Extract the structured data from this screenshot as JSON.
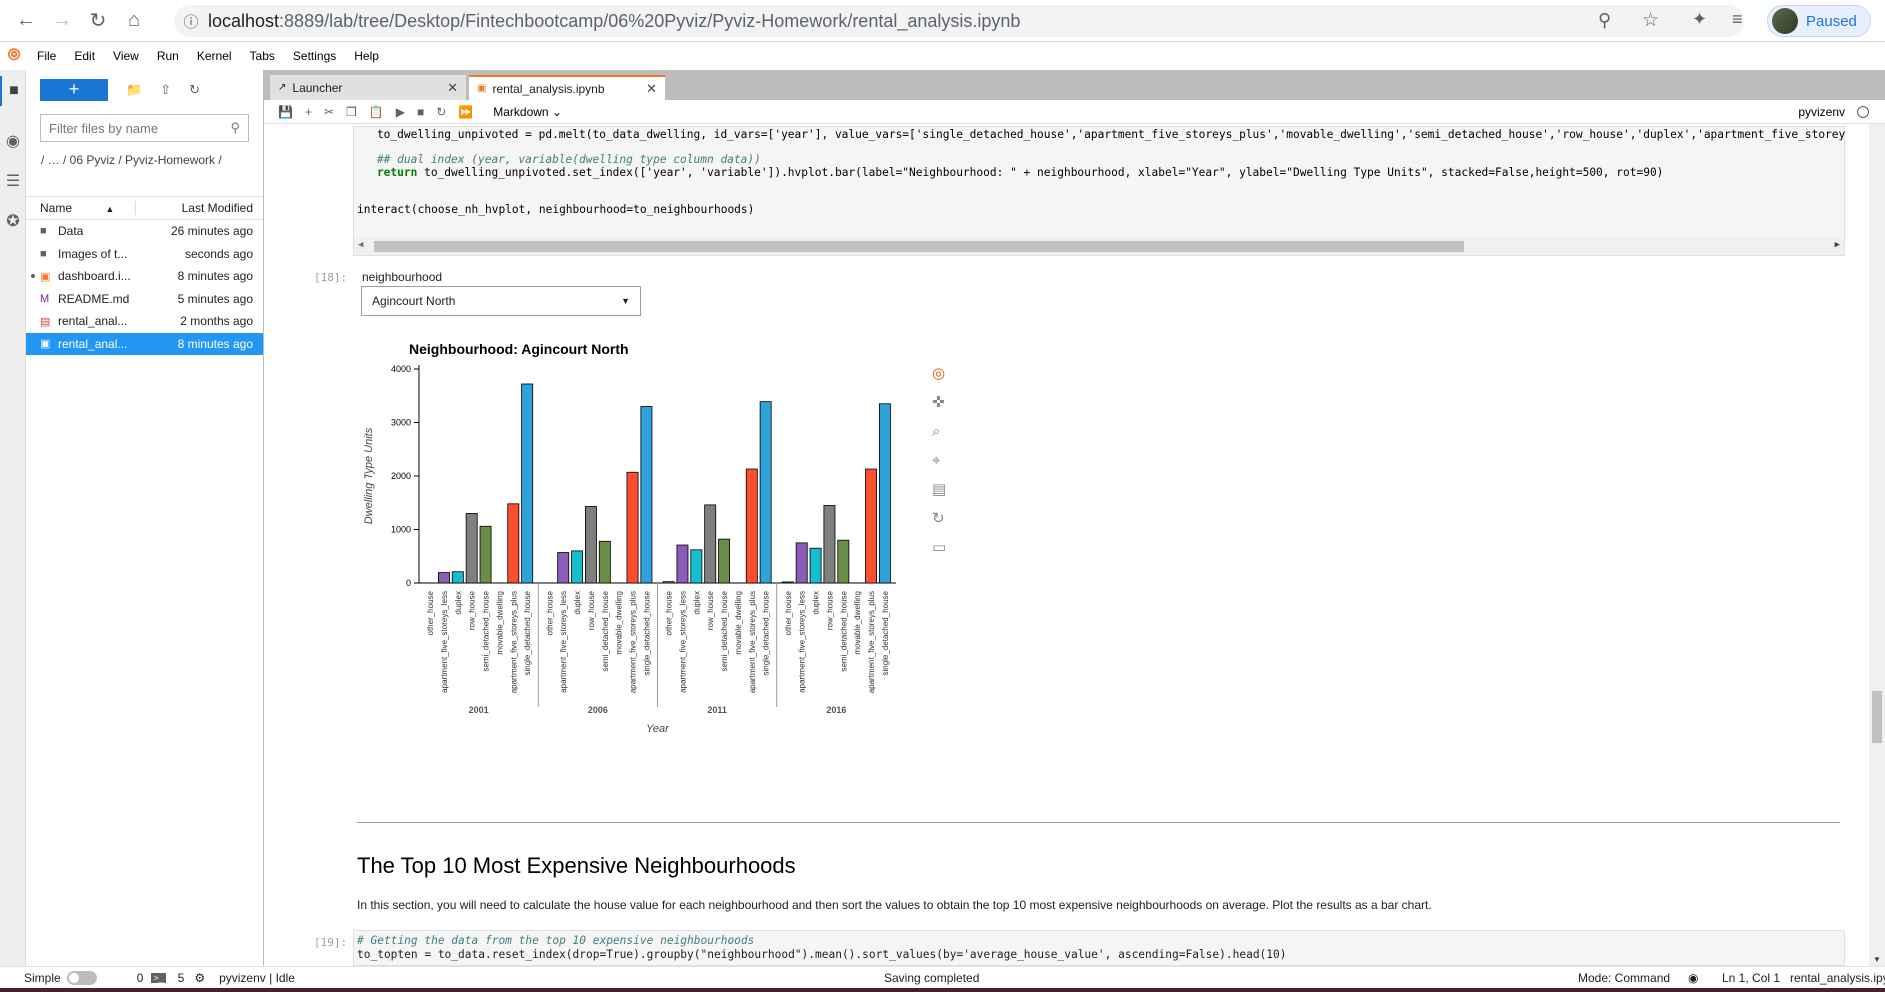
{
  "browser": {
    "url_host": "localhost",
    "url_path": ":8889/lab/tree/Desktop/Fintechbootcamp/06%20Pyviz/Pyviz-Homework/rental_analysis.ipynb",
    "profile_status": "Paused"
  },
  "menu": [
    "File",
    "Edit",
    "View",
    "Run",
    "Kernel",
    "Tabs",
    "Settings",
    "Help"
  ],
  "filebrowser": {
    "filter_placeholder": "Filter files by name",
    "breadcrumb": "/ … / 06 Pyviz / Pyviz-Homework /",
    "col_name": "Name",
    "col_modified": "Last Modified",
    "files": [
      {
        "icon": "folder-icon",
        "name": "Data",
        "modified": "26 minutes ago",
        "selected": false
      },
      {
        "icon": "folder-icon",
        "name": "Images of t...",
        "modified": "seconds ago",
        "selected": false
      },
      {
        "icon": "notebook-icon",
        "name": "dashboard.i...",
        "modified": "8 minutes ago",
        "selected": false
      },
      {
        "icon": "markdown-icon",
        "name": "README.md",
        "modified": "5 minutes ago",
        "selected": false
      },
      {
        "icon": "pdf-icon",
        "name": "rental_anal...",
        "modified": "2 months ago",
        "selected": false
      },
      {
        "icon": "notebook-icon",
        "name": "rental_anal...",
        "modified": "8 minutes ago",
        "selected": true
      }
    ]
  },
  "tabs": [
    {
      "label": "Launcher",
      "active": false
    },
    {
      "label": "rental_analysis.ipynb",
      "active": true
    }
  ],
  "toolbar": {
    "cell_type": "Markdown",
    "kernel": "pyvizenv"
  },
  "code_cell": {
    "line1": "    to_dwelling_unpivoted = pd.melt(to_data_dwelling, id_vars=['year'], value_vars=['single_detached_house','apartment_five_storeys_plus','movable_dwelling','semi_detached_house','row_house','duplex','apartment_five_storey",
    "line2": "    ## dual index (year, variable(dwelling type column data))",
    "line3a": "    return",
    "line3b": " to_dwelling_unpivoted.set_index(['year', 'variable']).hvplot.bar(label=\"Neighbourhood: \" + neighbourhood, xlabel=\"Year\", ylabel=\"Dwelling Type Units\", stacked=False,height=500, rot=90)",
    "line4": "interact(choose_nh_hvplot, neighbourhood=to_neighbourhoods)"
  },
  "output_cell": {
    "prompt": "[18]:",
    "widget_label": "neighbourhood",
    "dropdown_value": "Agincourt North"
  },
  "chart_data": {
    "type": "bar",
    "title": "Neighbourhood: Agincourt North",
    "xlabel": "Year",
    "ylabel": "Dwelling Type Units",
    "ylim": [
      0,
      4000
    ],
    "yticks": [
      0,
      1000,
      2000,
      3000,
      4000
    ],
    "groups": [
      "2001",
      "2006",
      "2011",
      "2016"
    ],
    "categories": [
      "other_house",
      "apartment_five_storeys_less",
      "duplex",
      "row_house",
      "semi_detached_house",
      "movable_dwelling",
      "apartment_five_storeys_plus",
      "single_detached_house"
    ],
    "colors": [
      "#30a2da",
      "#8b5cb8",
      "#17becf",
      "#7f7f7f",
      "#6a8e4a",
      "#8b5cb8",
      "#fc4f30",
      "#30a2da"
    ],
    "values": {
      "2001": [
        0,
        195,
        210,
        1300,
        1060,
        0,
        1480,
        3720
      ],
      "2006": [
        0,
        570,
        600,
        1430,
        780,
        0,
        2070,
        3300
      ],
      "2011": [
        25,
        710,
        620,
        1460,
        820,
        0,
        2130,
        3390
      ],
      "2016": [
        20,
        750,
        650,
        1450,
        800,
        0,
        2130,
        3350
      ]
    },
    "grid": false
  },
  "markdown": {
    "heading": "The Top 10 Most Expensive Neighbourhoods",
    "paragraph": "In this section, you will need to calculate the house value for each neighbourhood and then sort the values to obtain the top 10 most expensive neighbourhoods on average. Plot the results as a bar chart."
  },
  "code_cell2": {
    "prompt": "[19]:",
    "line1": "# Getting the data from the top 10 expensive neighbourhoods",
    "line2": "to_topten = to_data.reset_index(drop=True).groupby(\"neighbourhood\").mean().sort_values(by='average_house_value', ascending=False).head(10)"
  },
  "status": {
    "mode_label": "Simple",
    "count1": "0",
    "count2": "5",
    "kernel_state": "pyvizenv | Idle",
    "saving": "Saving completed",
    "mode": "Mode: Command",
    "position": "Ln 1, Col 1",
    "filename": "rental_analysis.ipynb"
  }
}
